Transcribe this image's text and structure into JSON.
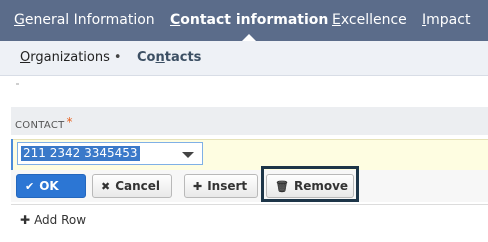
{
  "tabs": [
    {
      "prefix": "",
      "accel": "G",
      "rest": "eneral Information"
    },
    {
      "prefix": "",
      "accel": "C",
      "rest": "ontact information"
    },
    {
      "prefix": "",
      "accel": "E",
      "rest": "xcellence"
    },
    {
      "prefix": "",
      "accel": "I",
      "rest": "mpact"
    }
  ],
  "subtabs": [
    {
      "prefix": "",
      "accel": "O",
      "rest": "rganizations",
      "bullet": "•"
    },
    {
      "prefix": "Co",
      "accel": "n",
      "rest": "tacts"
    }
  ],
  "grid": {
    "column_label": "CONTACT",
    "required_mark": "*",
    "selected_value": "211 2342 3345453"
  },
  "buttons": {
    "ok": "OK",
    "cancel": "Cancel",
    "insert": "Insert",
    "remove": "Remove"
  },
  "add_row": "Add Row",
  "colors": {
    "topbar": "#5b6c8a",
    "accent": "#2c76d4",
    "edit_row": "#fefde1",
    "highlight": "#1d3548"
  }
}
